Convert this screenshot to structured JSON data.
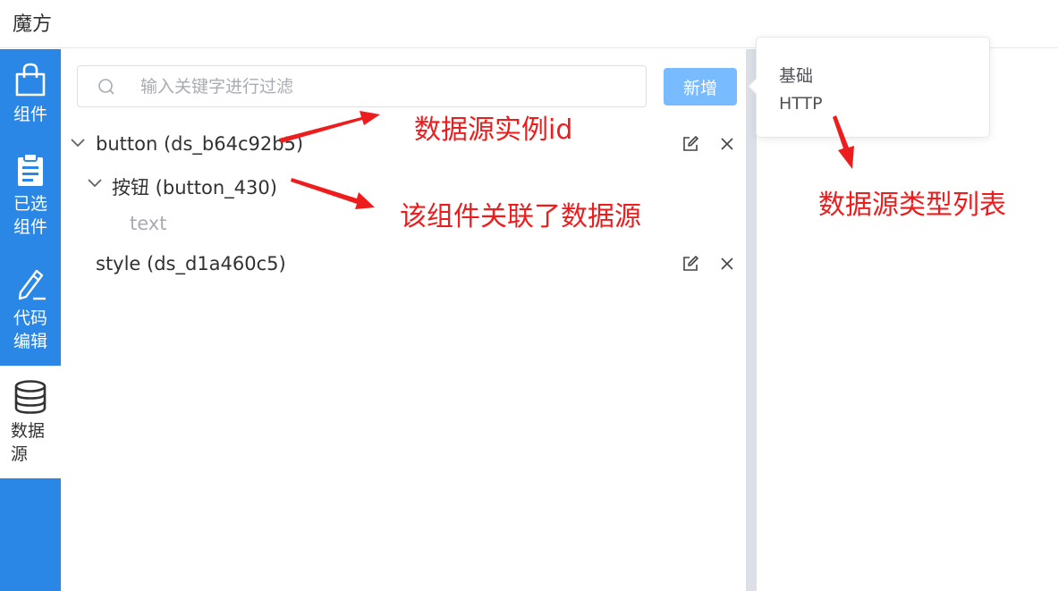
{
  "app": {
    "title": "魔方"
  },
  "sidebar": {
    "items": [
      {
        "label": "组件",
        "icon": "shopping-bag-icon"
      },
      {
        "label": "已选组件",
        "icon": "clipboard-icon"
      },
      {
        "label": "代码编辑",
        "icon": "pen-edit-icon"
      },
      {
        "label": "数据源",
        "icon": "database-icon",
        "active": true
      }
    ]
  },
  "search": {
    "placeholder": "输入关键字进行过滤",
    "value": ""
  },
  "toolbar": {
    "add_label": "新增"
  },
  "tree": [
    {
      "label": "button (ds_b64c92b5)",
      "expanded": true,
      "actions": [
        "edit-icon",
        "close-icon"
      ],
      "children": [
        {
          "label": "按钮 (button_430)",
          "expanded": true,
          "children": [
            {
              "label": "text"
            }
          ]
        }
      ]
    },
    {
      "label": "style (ds_d1a460c5)",
      "actions": [
        "edit-icon",
        "close-icon"
      ]
    }
  ],
  "popover": {
    "items": [
      "基础",
      "HTTP"
    ]
  },
  "annotations": {
    "instance_id": "数据源实例id",
    "component_linked": "该组件关联了数据源",
    "type_list": "数据源类型列表"
  },
  "colors": {
    "sidebar_bg": "#2a87e6",
    "primary_light": "#79bbff",
    "annotation_red": "#ee1d1d",
    "splitter": "#dcdfe6"
  }
}
